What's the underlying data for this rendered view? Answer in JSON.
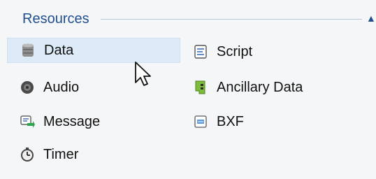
{
  "section": {
    "title": "Resources",
    "collapse_icon": "chevron-up-icon"
  },
  "items": [
    {
      "label": "Data",
      "icon": "database-icon",
      "selected": true
    },
    {
      "label": "Audio",
      "icon": "speaker-icon",
      "selected": false
    },
    {
      "label": "Message",
      "icon": "message-icon",
      "selected": false
    },
    {
      "label": "Timer",
      "icon": "stopwatch-icon",
      "selected": false
    },
    {
      "label": "Script",
      "icon": "script-icon",
      "selected": false
    },
    {
      "label": "Ancillary Data",
      "icon": "ancillary-data-icon",
      "selected": false
    },
    {
      "label": "BXF",
      "icon": "bxf-icon",
      "selected": false
    }
  ],
  "colors": {
    "header_text": "#1f4f8f",
    "selection_bg": "#dcebf7",
    "background": "#f5f6f8"
  }
}
